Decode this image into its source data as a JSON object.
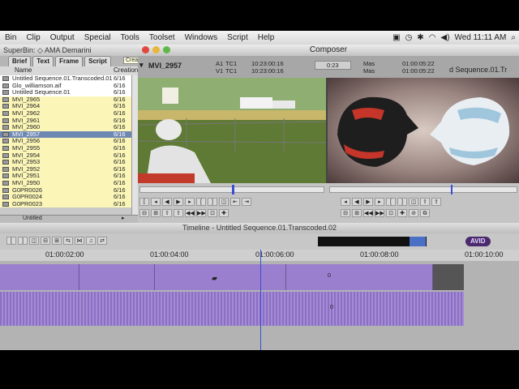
{
  "menubar": {
    "items": [
      "Bin",
      "Clip",
      "Output",
      "Special",
      "Tools",
      "Toolset",
      "Windows",
      "Script",
      "Help"
    ],
    "clock": "Wed 11:11 AM"
  },
  "superbin": {
    "title": "SuperBin: ◇ AMA Demarini",
    "tabs": [
      "Brief",
      "Text",
      "Frame",
      "Script"
    ],
    "tooltip": "Create Subclip",
    "col_name": "Name",
    "col_date": "Creation",
    "rows": [
      {
        "name": "Untitled Sequence.01.Transcoded.01",
        "date": "6/16",
        "style": "white"
      },
      {
        "name": "Glo_williamson.aif",
        "date": "6/16",
        "style": "white"
      },
      {
        "name": "Untitled Sequence.01",
        "date": "6/16",
        "style": "white"
      },
      {
        "name": "MVI_2965",
        "date": "6/16",
        "style": "yellow"
      },
      {
        "name": "MVI_2964",
        "date": "6/16",
        "style": "yellow"
      },
      {
        "name": "MVI_2962",
        "date": "6/16",
        "style": "yellow"
      },
      {
        "name": "MVI_2961",
        "date": "6/16",
        "style": "yellow"
      },
      {
        "name": "MVI_2960",
        "date": "6/16",
        "style": "yellow"
      },
      {
        "name": "MVI_2957",
        "date": "6/16",
        "style": "sel"
      },
      {
        "name": "MVI_2956",
        "date": "6/16",
        "style": "yellow"
      },
      {
        "name": "MVI_2955",
        "date": "6/16",
        "style": "yellow"
      },
      {
        "name": "MVI_2954",
        "date": "6/16",
        "style": "yellow"
      },
      {
        "name": "MVI_2953",
        "date": "6/16",
        "style": "yellow"
      },
      {
        "name": "MVI_2952",
        "date": "6/16",
        "style": "yellow"
      },
      {
        "name": "MVI_2951",
        "date": "6/16",
        "style": "yellow"
      },
      {
        "name": "MVI_2950",
        "date": "6/16",
        "style": "yellow"
      },
      {
        "name": "G0PR0026",
        "date": "6/16",
        "style": "yellow"
      },
      {
        "name": "G0PR0024",
        "date": "6/16",
        "style": "yellow"
      },
      {
        "name": "G0PR0023",
        "date": "6/16",
        "style": "yellow"
      }
    ],
    "footer": "Untitled"
  },
  "composer": {
    "title": "Composer",
    "source_clip": "MVI_2957",
    "track_a1": "A1",
    "track_v1": "V1",
    "tc_label": "TC1",
    "tc_a1": "10:23:00:16",
    "tc_v1": "10:23:00:16",
    "duration": "0:23",
    "mas_label": "Mas",
    "rec_tc_top": "01:00:05:22",
    "rec_tc_bottom": "01:00:05:22",
    "record_seq": "d Sequence.01.Tr"
  },
  "timeline": {
    "title": "Timeline - Untitled Sequence.01.Transcoded.02",
    "ruler": [
      "01:00:02:00",
      "01:00:04:00",
      "01:00:06:00",
      "01:00:08:00",
      "01:00:10:00"
    ],
    "clip_marker": "0",
    "audio_marker": "0",
    "avid_badge": "AVID"
  },
  "colors": {
    "selected_row": "#6f87b3",
    "clip_purple": "#9a7fce",
    "playhead": "#3a4fd2"
  }
}
